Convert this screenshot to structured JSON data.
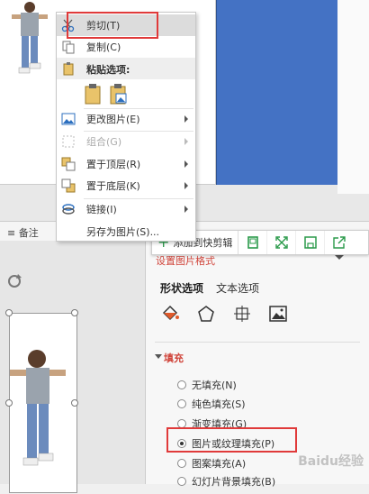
{
  "context_menu": {
    "cut": {
      "label": "剪切",
      "shortcut": "(T)"
    },
    "copy": {
      "label": "复制",
      "shortcut": "(C)"
    },
    "paste_options": "粘贴选项:",
    "change_picture": "更改图片(E)",
    "group": "组合(G)",
    "bring_front": "置于顶层(R)",
    "send_back": "置于底层(K)",
    "link": "链接(I)",
    "save_as_picture": "另存为图片(S)..."
  },
  "mini_toolbar": {
    "add_quick": "添加到快剪辑"
  },
  "notes_bar": {
    "label": "备注"
  },
  "format_panel": {
    "title": "设置图片格式",
    "tabs": [
      "形状选项",
      "文本选项"
    ],
    "fill_header": "填充",
    "fill_options": [
      {
        "label": "无填充(N)",
        "selected": false
      },
      {
        "label": "纯色填充(S)",
        "selected": false
      },
      {
        "label": "渐变填充(G)",
        "selected": false
      },
      {
        "label": "图片或纹理填充(P)",
        "selected": true
      },
      {
        "label": "图案填充(A)",
        "selected": false
      },
      {
        "label": "幻灯片背景填充(B)",
        "selected": false
      }
    ]
  },
  "colors": {
    "accent": "#d0443a",
    "highlight": "#e03a3a",
    "slide_blue": "#4472c4",
    "green_icon": "#2a9a4a"
  },
  "watermark": "Baidu经验"
}
